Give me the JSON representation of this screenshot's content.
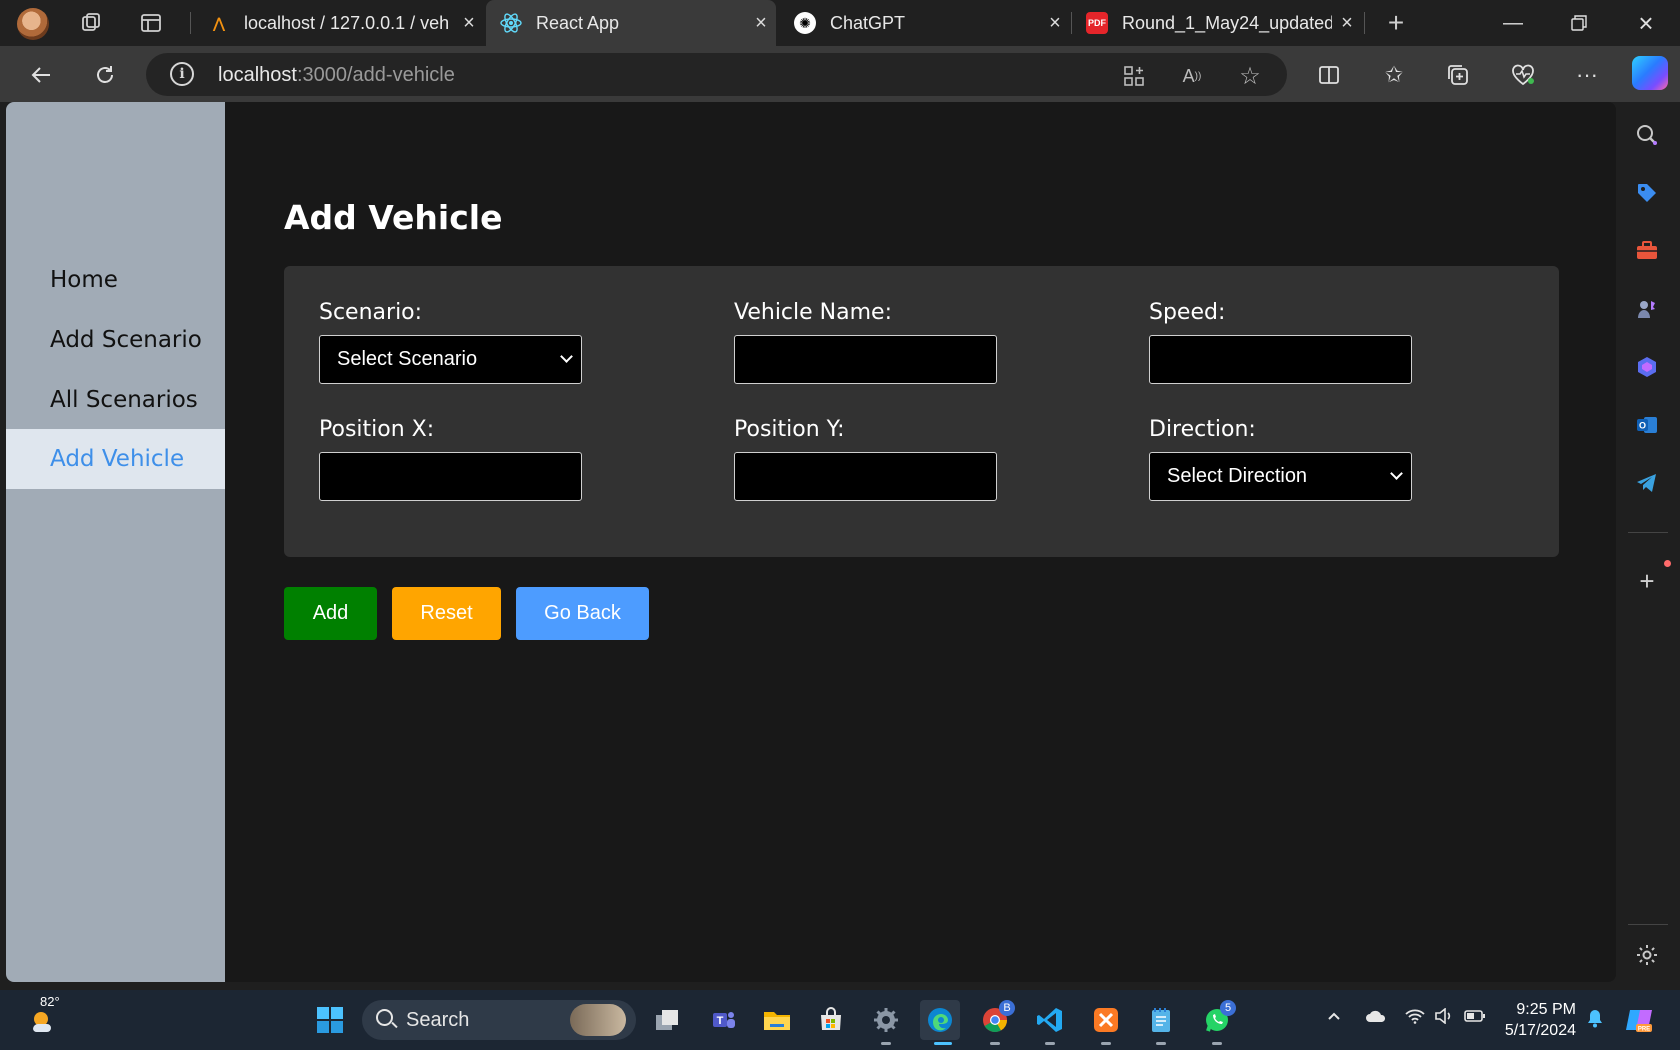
{
  "browser": {
    "tabs": [
      {
        "title": "localhost / 127.0.0.1 / veh",
        "favicon": "phpmyadmin-icon"
      },
      {
        "title": "React App",
        "favicon": "react-icon",
        "active": true
      },
      {
        "title": "ChatGPT",
        "favicon": "chatgpt-icon"
      },
      {
        "title": "Round_1_May24_updated",
        "favicon": "pdf-icon"
      }
    ],
    "url_host": "localhost",
    "url_path": ":3000/add-vehicle"
  },
  "sidebar": {
    "items": [
      {
        "label": "Home"
      },
      {
        "label": "Add Scenario"
      },
      {
        "label": "All Scenarios"
      },
      {
        "label": "Add Vehicle",
        "active": true
      }
    ]
  },
  "page": {
    "title": "Add Vehicle",
    "fields": {
      "scenario": {
        "label": "Scenario:",
        "selected": "Select Scenario"
      },
      "vehicle_name": {
        "label": "Vehicle Name:",
        "value": ""
      },
      "speed": {
        "label": "Speed:",
        "value": ""
      },
      "position_x": {
        "label": "Position X:",
        "value": ""
      },
      "position_y": {
        "label": "Position Y:",
        "value": ""
      },
      "direction": {
        "label": "Direction:",
        "selected": "Select Direction"
      }
    },
    "buttons": {
      "add": "Add",
      "reset": "Reset",
      "back": "Go Back"
    },
    "colors": {
      "add": "#008000",
      "reset": "#ffa500",
      "back": "#4d9cff",
      "accent": "#3e8fe9"
    }
  },
  "taskbar": {
    "weather": "82°",
    "search": "Search",
    "chrome_badge": "B",
    "whatsapp_badge": "5",
    "time": "9:25 PM",
    "date": "5/17/2024"
  }
}
